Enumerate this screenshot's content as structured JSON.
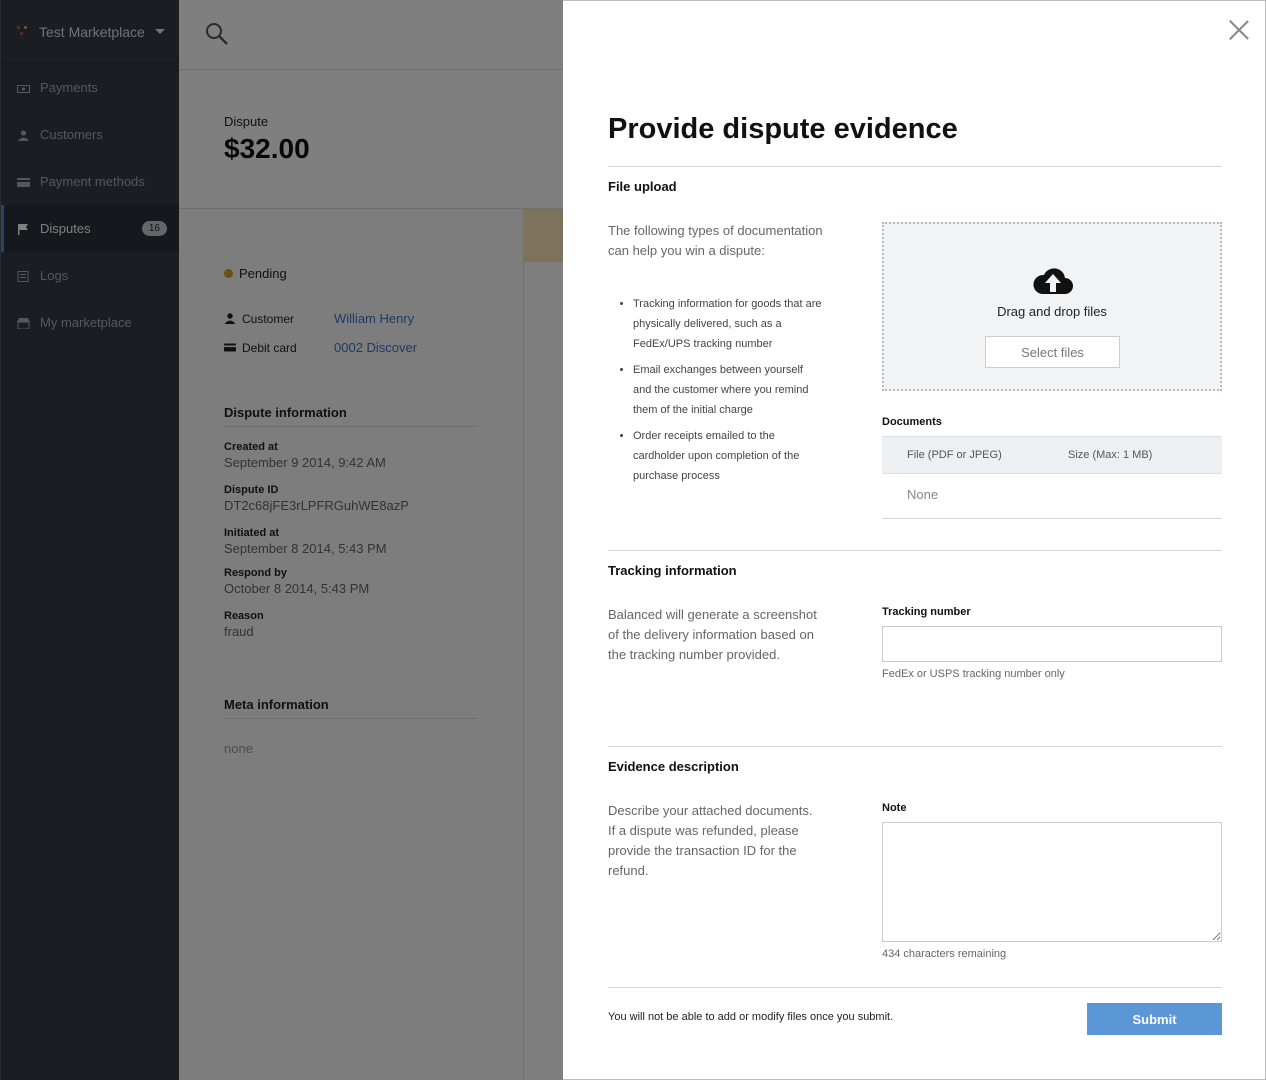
{
  "app": {
    "marketplace_name": "Test Marketplace",
    "nav": [
      {
        "label": "Payments",
        "icon": "payments-icon"
      },
      {
        "label": "Customers",
        "icon": "customers-icon"
      },
      {
        "label": "Payment methods",
        "icon": "card-icon"
      },
      {
        "label": "Disputes",
        "icon": "flag-icon",
        "badge": "16",
        "active": true
      },
      {
        "label": "Logs",
        "icon": "logs-icon"
      },
      {
        "label": "My marketplace",
        "icon": "marketplace-icon"
      }
    ]
  },
  "dispute": {
    "label": "Dispute",
    "amount": "$32.00",
    "status": "Pending",
    "customer_label": "Customer",
    "customer_value": "William Henry",
    "card_label": "Debit card",
    "card_value": "0002 Discover",
    "info_title": "Dispute information",
    "fields": [
      {
        "key": "Created at",
        "value": "September 9 2014, 9:42 AM"
      },
      {
        "key": "Dispute ID",
        "value": "DT2c68jFE3rLPFRGuhWE8azP"
      },
      {
        "key": "Initiated at",
        "value": "September 8 2014, 5:43 PM"
      },
      {
        "key": "Respond by",
        "value": "October 8 2014, 5:43 PM"
      },
      {
        "key": "Reason",
        "value": "fraud"
      }
    ],
    "meta_title": "Meta information",
    "meta_value": "none"
  },
  "modal": {
    "title": "Provide dispute evidence",
    "file_upload": {
      "heading": "File upload",
      "intro": "The following types of documentation can help you win a dispute:",
      "bullets": [
        "Tracking information for goods that are physically delivered, such as a FedEx/UPS tracking number",
        "Email exchanges between yourself and the customer where you remind them of the initial charge",
        "Order receipts emailed to the cardholder upon completion of the purchase process"
      ],
      "drop_text": "Drag and drop files",
      "select_label": "Select files",
      "documents_label": "Documents",
      "col_file": "File (PDF or JPEG)",
      "col_size": "Size (Max: 1 MB)",
      "empty": "None"
    },
    "tracking": {
      "heading": "Tracking information",
      "description": "Balanced will generate a screenshot of the delivery information based on the tracking number provided.",
      "field_label": "Tracking number",
      "value": "",
      "hint": "FedEx or USPS tracking number only"
    },
    "evidence": {
      "heading": "Evidence description",
      "description": "Describe your attached documents. If a dispute was refunded, please provide the transaction ID for the refund.",
      "field_label": "Note",
      "value": "",
      "remaining": "434 characters remaining"
    },
    "footer": {
      "warning": "You will not be able to add or modify files once you submit.",
      "submit_label": "Submit"
    }
  },
  "colors": {
    "sidebar_bg": "#343a45",
    "accent": "#4b8bd4",
    "submit": "#5b97d6",
    "pending": "#d6a31c"
  }
}
